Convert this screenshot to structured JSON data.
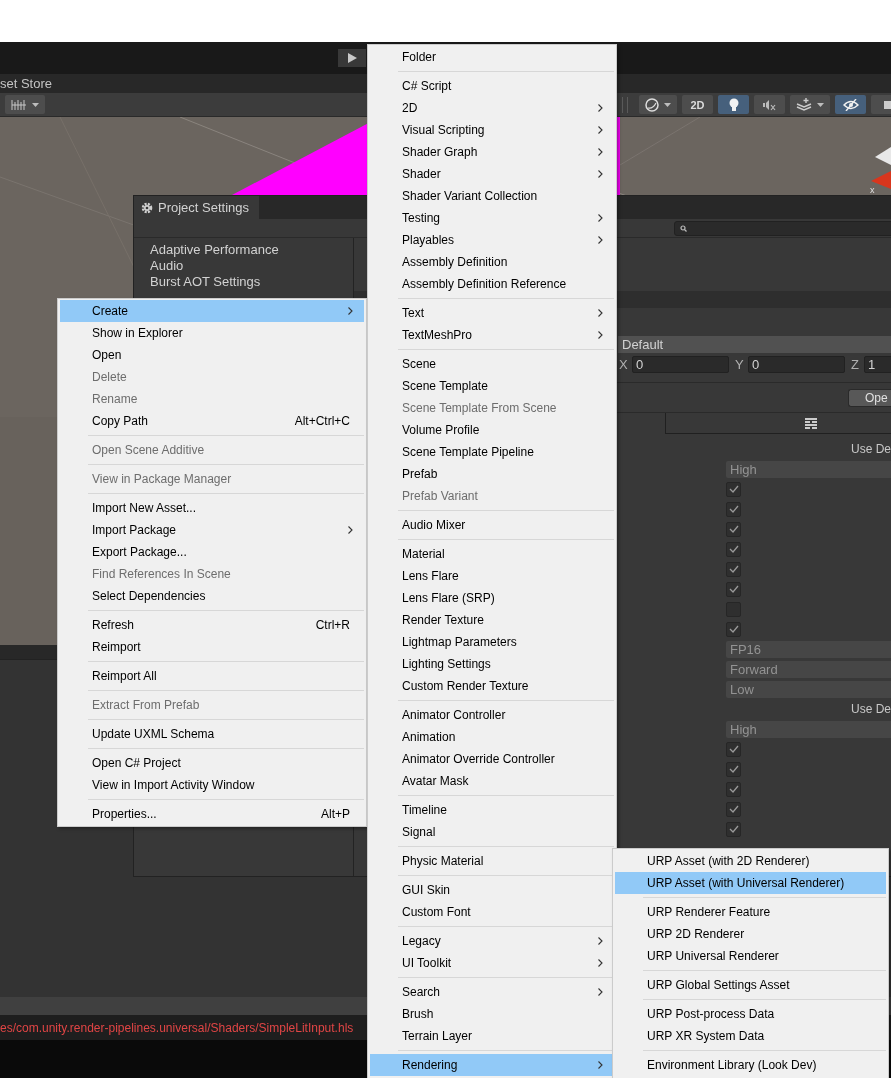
{
  "tab_bar": {
    "tab": "set Store"
  },
  "scene_toolbar": {
    "left": [
      {
        "kind": "snap",
        "dropdown": true,
        "selected": false
      }
    ],
    "right": [
      {
        "kind": "sphere",
        "dropdown": true,
        "selected": false
      },
      {
        "kind": "text",
        "label": "2D",
        "selected": false
      },
      {
        "kind": "light",
        "selected": true
      },
      {
        "kind": "audio",
        "selected": false
      },
      {
        "kind": "effects",
        "dropdown": true,
        "selected": false
      },
      {
        "kind": "visibility",
        "selected": true
      },
      {
        "kind": "camera",
        "selected": false
      }
    ]
  },
  "gizmo": {
    "axis_label": "x"
  },
  "project_settings": {
    "title": "Project Settings",
    "categories": [
      "Adaptive Performance",
      "Audio",
      "Burst AOT Settings"
    ],
    "preset": "Default",
    "position": [
      {
        "axis": "X",
        "value": "0"
      },
      {
        "axis": "Y",
        "value": "0"
      },
      {
        "axis": "Z",
        "value": "1"
      }
    ],
    "open_button": "Ope",
    "rows": [
      {
        "kind": "label",
        "text": "Use De"
      },
      {
        "kind": "dropdown",
        "value": "High",
        "disabled": true
      },
      {
        "kind": "checkbox",
        "checked": true
      },
      {
        "kind": "checkbox",
        "checked": true
      },
      {
        "kind": "checkbox",
        "checked": true
      },
      {
        "kind": "checkbox",
        "checked": true
      },
      {
        "kind": "checkbox",
        "checked": true
      },
      {
        "kind": "checkbox",
        "checked": true
      },
      {
        "kind": "checkbox",
        "checked": false
      },
      {
        "kind": "checkbox",
        "checked": true
      },
      {
        "kind": "dropdown",
        "value": "FP16",
        "disabled": true
      },
      {
        "kind": "dropdown",
        "value": "Forward",
        "disabled": true
      },
      {
        "kind": "dropdown",
        "value": "Low",
        "disabled": true
      },
      {
        "kind": "label",
        "text": "Use De"
      },
      {
        "kind": "dropdown",
        "value": "High",
        "disabled": true
      },
      {
        "kind": "checkbox",
        "checked": true
      },
      {
        "kind": "checkbox",
        "checked": true
      },
      {
        "kind": "checkbox",
        "checked": true
      },
      {
        "kind": "checkbox",
        "checked": true
      },
      {
        "kind": "checkbox",
        "checked": true
      }
    ]
  },
  "console": {
    "message": "es/com.unity.render-pipelines.universal/Shaders/SimpleLitInput.hls"
  },
  "context_menu": {
    "items": [
      {
        "kind": "item",
        "label": "Create",
        "submenu": true,
        "selected": true,
        "disabled": false
      },
      {
        "kind": "item",
        "label": "Show in Explorer",
        "selected": false,
        "disabled": false
      },
      {
        "kind": "item",
        "label": "Open",
        "selected": false,
        "disabled": false
      },
      {
        "kind": "item",
        "label": "Delete",
        "selected": false,
        "disabled": true
      },
      {
        "kind": "item",
        "label": "Rename",
        "selected": false,
        "disabled": true
      },
      {
        "kind": "item",
        "label": "Copy Path",
        "shortcut": "Alt+Ctrl+C",
        "selected": false,
        "disabled": false
      },
      {
        "kind": "separator"
      },
      {
        "kind": "item",
        "label": "Open Scene Additive",
        "selected": false,
        "disabled": true
      },
      {
        "kind": "separator"
      },
      {
        "kind": "item",
        "label": "View in Package Manager",
        "selected": false,
        "disabled": true
      },
      {
        "kind": "separator"
      },
      {
        "kind": "item",
        "label": "Import New Asset...",
        "selected": false,
        "disabled": false
      },
      {
        "kind": "item",
        "label": "Import Package",
        "submenu": true,
        "selected": false,
        "disabled": false
      },
      {
        "kind": "item",
        "label": "Export Package...",
        "selected": false,
        "disabled": false
      },
      {
        "kind": "item",
        "label": "Find References In Scene",
        "selected": false,
        "disabled": true
      },
      {
        "kind": "item",
        "label": "Select Dependencies",
        "selected": false,
        "disabled": false
      },
      {
        "kind": "separator"
      },
      {
        "kind": "item",
        "label": "Refresh",
        "shortcut": "Ctrl+R",
        "selected": false,
        "disabled": false
      },
      {
        "kind": "item",
        "label": "Reimport",
        "selected": false,
        "disabled": false
      },
      {
        "kind": "separator"
      },
      {
        "kind": "item",
        "label": "Reimport All",
        "selected": false,
        "disabled": false
      },
      {
        "kind": "separator"
      },
      {
        "kind": "item",
        "label": "Extract From Prefab",
        "selected": false,
        "disabled": true
      },
      {
        "kind": "separator"
      },
      {
        "kind": "item",
        "label": "Update UXML Schema",
        "selected": false,
        "disabled": false
      },
      {
        "kind": "separator"
      },
      {
        "kind": "item",
        "label": "Open C# Project",
        "selected": false,
        "disabled": false
      },
      {
        "kind": "item",
        "label": "View in Import Activity Window",
        "selected": false,
        "disabled": false
      },
      {
        "kind": "separator"
      },
      {
        "kind": "item",
        "label": "Properties...",
        "shortcut": "Alt+P",
        "selected": false,
        "disabled": false
      }
    ]
  },
  "create_menu": {
    "items": [
      {
        "kind": "item",
        "label": "Folder",
        "selected": false,
        "disabled": false
      },
      {
        "kind": "separator"
      },
      {
        "kind": "item",
        "label": "C# Script",
        "selected": false,
        "disabled": false
      },
      {
        "kind": "item",
        "label": "2D",
        "submenu": true,
        "selected": false,
        "disabled": false
      },
      {
        "kind": "item",
        "label": "Visual Scripting",
        "submenu": true,
        "selected": false,
        "disabled": false
      },
      {
        "kind": "item",
        "label": "Shader Graph",
        "submenu": true,
        "selected": false,
        "disabled": false
      },
      {
        "kind": "item",
        "label": "Shader",
        "submenu": true,
        "selected": false,
        "disabled": false
      },
      {
        "kind": "item",
        "label": "Shader Variant Collection",
        "selected": false,
        "disabled": false
      },
      {
        "kind": "item",
        "label": "Testing",
        "submenu": true,
        "selected": false,
        "disabled": false
      },
      {
        "kind": "item",
        "label": "Playables",
        "submenu": true,
        "selected": false,
        "disabled": false
      },
      {
        "kind": "item",
        "label": "Assembly Definition",
        "selected": false,
        "disabled": false
      },
      {
        "kind": "item",
        "label": "Assembly Definition Reference",
        "selected": false,
        "disabled": false
      },
      {
        "kind": "separator"
      },
      {
        "kind": "item",
        "label": "Text",
        "submenu": true,
        "selected": false,
        "disabled": false
      },
      {
        "kind": "item",
        "label": "TextMeshPro",
        "submenu": true,
        "selected": false,
        "disabled": false
      },
      {
        "kind": "separator"
      },
      {
        "kind": "item",
        "label": "Scene",
        "selected": false,
        "disabled": false
      },
      {
        "kind": "item",
        "label": "Scene Template",
        "selected": false,
        "disabled": false
      },
      {
        "kind": "item",
        "label": "Scene Template From Scene",
        "selected": false,
        "disabled": true
      },
      {
        "kind": "item",
        "label": "Volume Profile",
        "selected": false,
        "disabled": false
      },
      {
        "kind": "item",
        "label": "Scene Template Pipeline",
        "selected": false,
        "disabled": false
      },
      {
        "kind": "item",
        "label": "Prefab",
        "selected": false,
        "disabled": false
      },
      {
        "kind": "item",
        "label": "Prefab Variant",
        "selected": false,
        "disabled": true
      },
      {
        "kind": "separator"
      },
      {
        "kind": "item",
        "label": "Audio Mixer",
        "selected": false,
        "disabled": false
      },
      {
        "kind": "separator"
      },
      {
        "kind": "item",
        "label": "Material",
        "selected": false,
        "disabled": false
      },
      {
        "kind": "item",
        "label": "Lens Flare",
        "selected": false,
        "disabled": false
      },
      {
        "kind": "item",
        "label": "Lens Flare (SRP)",
        "selected": false,
        "disabled": false
      },
      {
        "kind": "item",
        "label": "Render Texture",
        "selected": false,
        "disabled": false
      },
      {
        "kind": "item",
        "label": "Lightmap Parameters",
        "selected": false,
        "disabled": false
      },
      {
        "kind": "item",
        "label": "Lighting Settings",
        "selected": false,
        "disabled": false
      },
      {
        "kind": "item",
        "label": "Custom Render Texture",
        "selected": false,
        "disabled": false
      },
      {
        "kind": "separator"
      },
      {
        "kind": "item",
        "label": "Animator Controller",
        "selected": false,
        "disabled": false
      },
      {
        "kind": "item",
        "label": "Animation",
        "selected": false,
        "disabled": false
      },
      {
        "kind": "item",
        "label": "Animator Override Controller",
        "selected": false,
        "disabled": false
      },
      {
        "kind": "item",
        "label": "Avatar Mask",
        "selected": false,
        "disabled": false
      },
      {
        "kind": "separator"
      },
      {
        "kind": "item",
        "label": "Timeline",
        "selected": false,
        "disabled": false
      },
      {
        "kind": "item",
        "label": "Signal",
        "selected": false,
        "disabled": false
      },
      {
        "kind": "separator"
      },
      {
        "kind": "item",
        "label": "Physic Material",
        "selected": false,
        "disabled": false
      },
      {
        "kind": "separator"
      },
      {
        "kind": "item",
        "label": "GUI Skin",
        "selected": false,
        "disabled": false
      },
      {
        "kind": "item",
        "label": "Custom Font",
        "selected": false,
        "disabled": false
      },
      {
        "kind": "separator"
      },
      {
        "kind": "item",
        "label": "Legacy",
        "submenu": true,
        "selected": false,
        "disabled": false
      },
      {
        "kind": "item",
        "label": "UI Toolkit",
        "submenu": true,
        "selected": false,
        "disabled": false
      },
      {
        "kind": "separator"
      },
      {
        "kind": "item",
        "label": "Search",
        "submenu": true,
        "selected": false,
        "disabled": false
      },
      {
        "kind": "item",
        "label": "Brush",
        "selected": false,
        "disabled": false
      },
      {
        "kind": "item",
        "label": "Terrain Layer",
        "selected": false,
        "disabled": false
      },
      {
        "kind": "separator"
      },
      {
        "kind": "item",
        "label": "Rendering",
        "submenu": true,
        "selected": true,
        "disabled": false
      }
    ]
  },
  "rendering_menu": {
    "items": [
      {
        "kind": "item",
        "label": "URP Asset (with 2D Renderer)",
        "selected": false,
        "disabled": false
      },
      {
        "kind": "item",
        "label": "URP Asset (with Universal Renderer)",
        "selected": true,
        "disabled": false
      },
      {
        "kind": "separator"
      },
      {
        "kind": "item",
        "label": "URP Renderer Feature",
        "selected": false,
        "disabled": false
      },
      {
        "kind": "item",
        "label": "URP 2D Renderer",
        "selected": false,
        "disabled": false
      },
      {
        "kind": "item",
        "label": "URP Universal Renderer",
        "selected": false,
        "disabled": false
      },
      {
        "kind": "separator"
      },
      {
        "kind": "item",
        "label": "URP Global Settings Asset",
        "selected": false,
        "disabled": false
      },
      {
        "kind": "separator"
      },
      {
        "kind": "item",
        "label": "URP Post-process Data",
        "selected": false,
        "disabled": false
      },
      {
        "kind": "item",
        "label": "URP XR System Data",
        "selected": false,
        "disabled": false
      },
      {
        "kind": "separator"
      },
      {
        "kind": "item",
        "label": "Environment Library (Look Dev)",
        "selected": false,
        "disabled": false
      }
    ]
  }
}
